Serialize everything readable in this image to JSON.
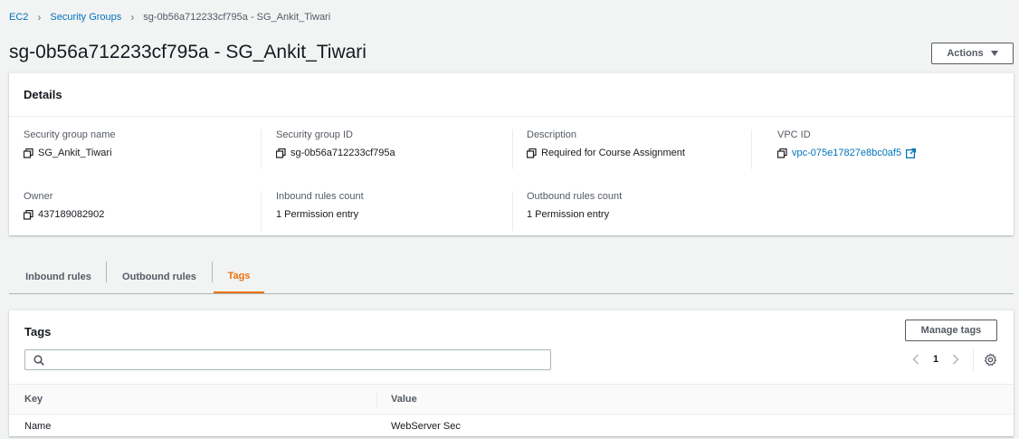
{
  "breadcrumb": {
    "items": [
      "EC2",
      "Security Groups"
    ],
    "current": "sg-0b56a712233cf795a - SG_Ankit_Tiwari"
  },
  "page": {
    "title": "sg-0b56a712233cf795a - SG_Ankit_Tiwari",
    "actions_label": "Actions"
  },
  "details": {
    "heading": "Details",
    "fields": {
      "sg_name": {
        "label": "Security group name",
        "value": "SG_Ankit_Tiwari",
        "icon": "copy-icon"
      },
      "sg_id": {
        "label": "Security group ID",
        "value": "sg-0b56a712233cf795a",
        "icon": "copy-icon"
      },
      "description": {
        "label": "Description",
        "value": "Required for Course Assignment",
        "icon": "copy-icon"
      },
      "vpc_id": {
        "label": "VPC ID",
        "value": "vpc-075e17827e8bc0af5",
        "icon": "external-link-icon"
      },
      "owner": {
        "label": "Owner",
        "value": "437189082902",
        "icon": "copy-icon"
      },
      "inbound_count": {
        "label": "Inbound rules count",
        "value": "1 Permission entry"
      },
      "outbound_count": {
        "label": "Outbound rules count",
        "value": "1 Permission entry"
      }
    }
  },
  "tabs": [
    {
      "label": "Inbound rules",
      "active": false
    },
    {
      "label": "Outbound rules",
      "active": false
    },
    {
      "label": "Tags",
      "active": true
    }
  ],
  "tags": {
    "heading": "Tags",
    "manage_label": "Manage tags",
    "search_placeholder": "",
    "page": "1",
    "columns": [
      "Key",
      "Value"
    ],
    "rows": [
      {
        "key": "Name",
        "value": "WebServer Sec"
      }
    ]
  },
  "colors": {
    "link": "#0073bb",
    "active_tab": "#ec7211",
    "text": "#16191f",
    "muted": "#545b64"
  }
}
